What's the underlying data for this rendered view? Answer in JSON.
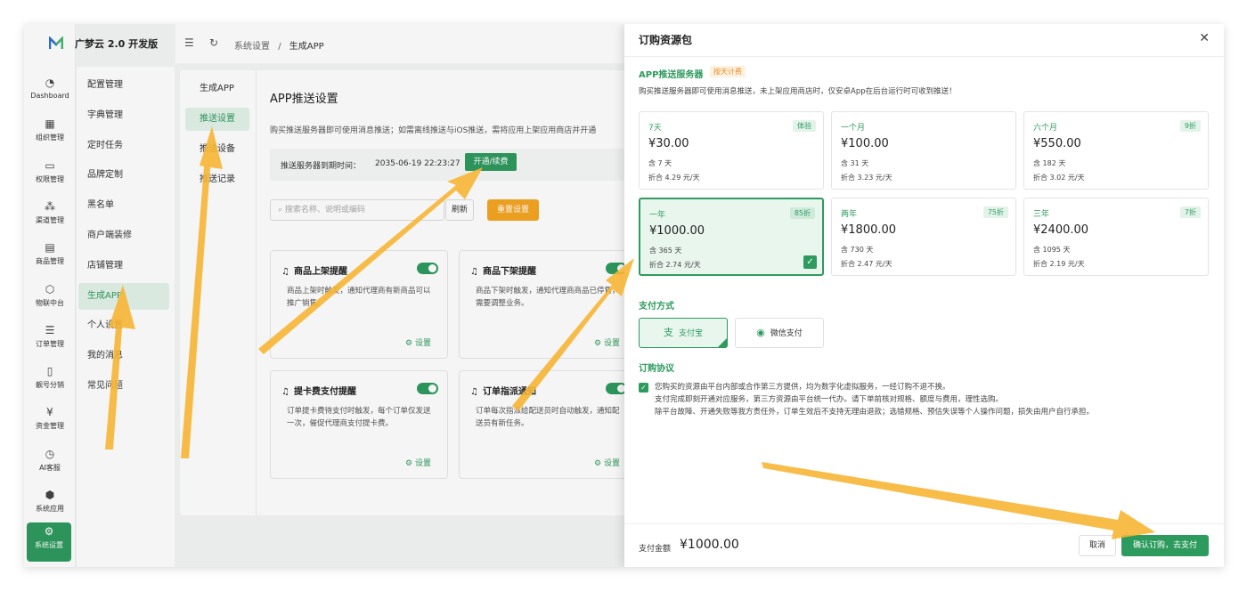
{
  "app": {
    "brand": "广梦云 2.0 开发版"
  },
  "rail": [
    {
      "label": "Dashboard",
      "icon": "dashboard-icon",
      "glyph": "◔"
    },
    {
      "label": "组织管理",
      "icon": "grid-icon",
      "glyph": "▦"
    },
    {
      "label": "权限管理",
      "icon": "monitor-icon",
      "glyph": "▭"
    },
    {
      "label": "渠道管理",
      "icon": "network-icon",
      "glyph": "⁂"
    },
    {
      "label": "商品管理",
      "icon": "shop-icon",
      "glyph": "▤"
    },
    {
      "label": "物联中台",
      "icon": "cube-icon",
      "glyph": "⬡"
    },
    {
      "label": "订单管理",
      "icon": "list-icon",
      "glyph": "☰"
    },
    {
      "label": "靓号分销",
      "icon": "phone-icon",
      "glyph": "▯"
    },
    {
      "label": "资金管理",
      "icon": "yen-icon",
      "glyph": "¥"
    },
    {
      "label": "AI客服",
      "icon": "chat-icon",
      "glyph": "◷"
    },
    {
      "label": "系统应用",
      "icon": "box-icon",
      "glyph": "⬢"
    },
    {
      "label": "系统设置",
      "icon": "gear-icon",
      "glyph": "⚙"
    }
  ],
  "menu": [
    "配置管理",
    "字典管理",
    "定时任务",
    "品牌定制",
    "黑名单",
    "商户端装修",
    "店铺管理",
    "生成APP",
    "个人设置",
    "我的消息",
    "常见问题"
  ],
  "breadcrumb": {
    "parent": "系统设置",
    "sep": "/",
    "current": "生成APP"
  },
  "subnav": [
    "生成APP",
    "推送设置",
    "推送设备",
    "推送记录"
  ],
  "page": {
    "title": "APP推送设置",
    "desc": "购买推送服务器即可使用消息推送；如需离线推送与iOS推送，需将应用上架应用商店并开通",
    "expire_label": "推送服务器到期时间：",
    "expire_value": "2035-06-19 22:23:27",
    "renew": "开通/续费",
    "search_placeholder": "搜索名称、说明或编码",
    "refresh": "刷新",
    "reset": "重置设置",
    "settings": "设置"
  },
  "cards": [
    {
      "title": "商品上架提醒",
      "desc": "商品上架时触发，通知代理商有新商品可以推广销售。"
    },
    {
      "title": "商品下架提醒",
      "desc": "商品下架时触发，通知代理商商品已停售，需要调整业务。"
    },
    {
      "title": "提卡费支付提醒",
      "desc": "订单提卡费待支付时触发，每个订单仅发送一次，催促代理商支付提卡费。"
    },
    {
      "title": "订单指派通知",
      "desc": "订单每次指派给配送员时自动触发，通知配送员有新任务。"
    }
  ],
  "drawer": {
    "title": "订购资源包",
    "section": "APP推送服务器",
    "billing_tag": "按天计费",
    "note": "购买推送服务器即可使用消息推送，未上架应用商店时，仅安卓App在后台运行时可收到推送！",
    "plans": [
      {
        "name": "7天",
        "badge": "体验",
        "price": "¥30.00",
        "days": "含 7 天",
        "rate": "折合 4.29 元/天",
        "selected": false
      },
      {
        "name": "一个月",
        "badge": "",
        "price": "¥100.00",
        "days": "含 31 天",
        "rate": "折合 3.23 元/天",
        "selected": false
      },
      {
        "name": "六个月",
        "badge": "9折",
        "price": "¥550.00",
        "days": "含 182 天",
        "rate": "折合 3.02 元/天",
        "selected": false
      },
      {
        "name": "一年",
        "badge": "85折",
        "price": "¥1000.00",
        "days": "含 365 天",
        "rate": "折合 2.74 元/天",
        "selected": true
      },
      {
        "name": "两年",
        "badge": "75折",
        "price": "¥1800.00",
        "days": "含 730 天",
        "rate": "折合 2.47 元/天",
        "selected": false
      },
      {
        "name": "三年",
        "badge": "7折",
        "price": "¥2400.00",
        "days": "含 1095 天",
        "rate": "折合 2.19 元/天",
        "selected": false
      }
    ],
    "pay_title": "支付方式",
    "alipay": "支付宝",
    "wechat": "微信支付",
    "agreement_title": "订购协议",
    "agreement": [
      "您购买的资源由平台内部或合作第三方提供，均为数字化虚拟服务，一经订购不退不换。",
      "支付完成即刻开通对应服务，第三方资源由平台统一代办。请下单前核对规格、额度与费用，理性选购。",
      "除平台故障、开通失败等我方责任外，订单生效后不支持无理由退款；选错规格、预估失误等个人操作问题，损失由用户自行承担。"
    ],
    "amount_label": "支付金额",
    "amount": "¥1000.00",
    "cancel": "取消",
    "confirm": "确认订购，去支付"
  },
  "colors": {
    "accent": "#2e9b5e",
    "warning": "#f5a623",
    "arrow": "#f7b535"
  }
}
